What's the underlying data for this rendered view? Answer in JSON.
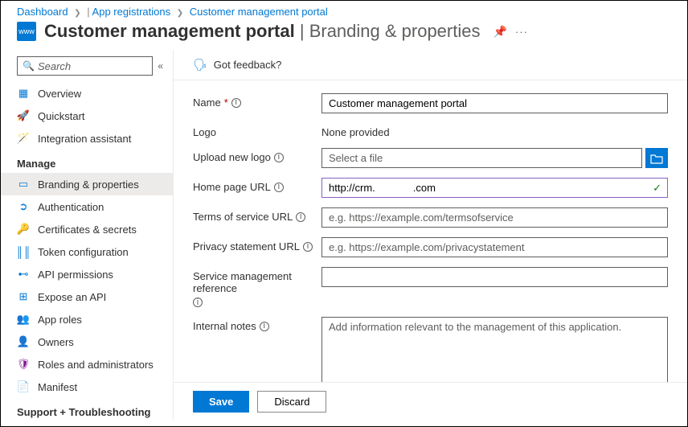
{
  "breadcrumbs": {
    "items": [
      "Dashboard",
      "App registrations",
      "Customer management portal"
    ]
  },
  "header": {
    "title": "Customer management portal",
    "subtitle": "Branding & properties"
  },
  "sidebar": {
    "search_placeholder": "Search",
    "items": [
      {
        "label": "Overview",
        "icon": "overview"
      },
      {
        "label": "Quickstart",
        "icon": "quickstart"
      },
      {
        "label": "Integration assistant",
        "icon": "integration"
      }
    ],
    "manage_header": "Manage",
    "manage_items": [
      {
        "label": "Branding & properties",
        "icon": "branding",
        "active": true
      },
      {
        "label": "Authentication",
        "icon": "auth"
      },
      {
        "label": "Certificates & secrets",
        "icon": "certs"
      },
      {
        "label": "Token configuration",
        "icon": "token"
      },
      {
        "label": "API permissions",
        "icon": "api"
      },
      {
        "label": "Expose an API",
        "icon": "expose"
      },
      {
        "label": "App roles",
        "icon": "roles"
      },
      {
        "label": "Owners",
        "icon": "owners"
      },
      {
        "label": "Roles and administrators",
        "icon": "admins"
      },
      {
        "label": "Manifest",
        "icon": "manifest"
      }
    ],
    "support_header": "Support + Troubleshooting"
  },
  "feedback": {
    "label": "Got feedback?"
  },
  "form": {
    "name_label": "Name",
    "name_value": "Customer management portal",
    "logo_label": "Logo",
    "logo_value": "None provided",
    "upload_label": "Upload new logo",
    "upload_placeholder": "Select a file",
    "homepage_label": "Home page URL",
    "homepage_value": "http://crm.             .com",
    "tos_label": "Terms of service URL",
    "tos_placeholder": "e.g. https://example.com/termsofservice",
    "privacy_label": "Privacy statement URL",
    "privacy_placeholder": "e.g. https://example.com/privacystatement",
    "service_ref_label": "Service management reference",
    "notes_label": "Internal notes",
    "notes_placeholder": "Add information relevant to the management of this application."
  },
  "footer": {
    "save": "Save",
    "discard": "Discard"
  }
}
